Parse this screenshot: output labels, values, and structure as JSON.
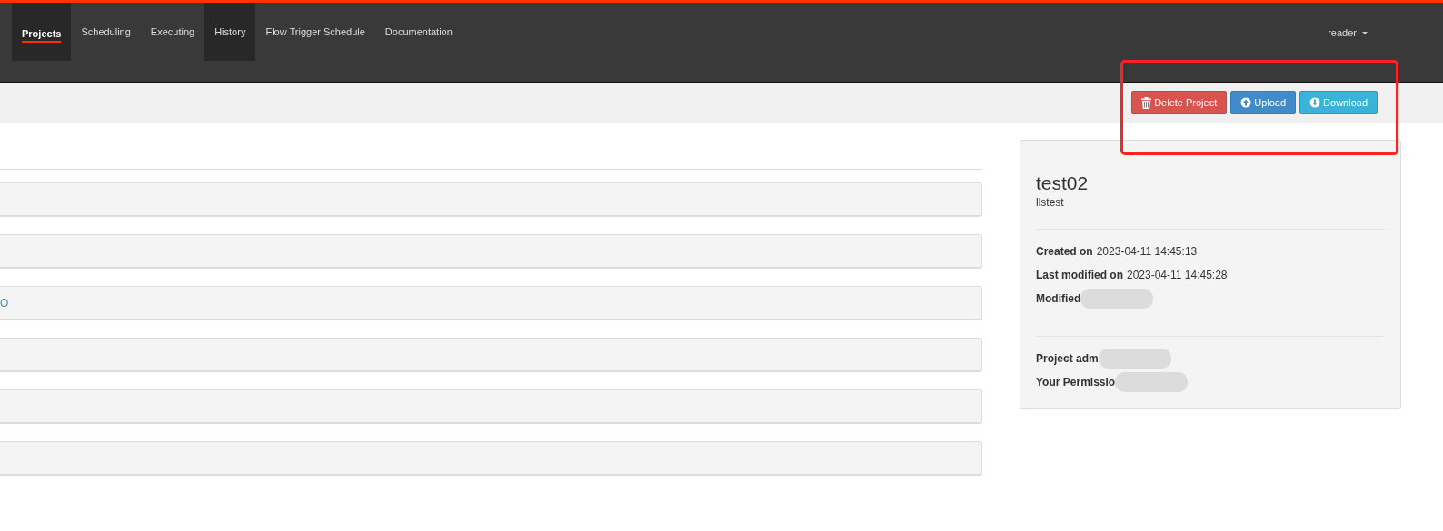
{
  "navbar": {
    "items": [
      {
        "label": "Projects",
        "selected": true,
        "highlighted": true
      },
      {
        "label": "Scheduling",
        "selected": false,
        "highlighted": false
      },
      {
        "label": "Executing",
        "selected": false,
        "highlighted": false
      },
      {
        "label": "History",
        "selected": false,
        "highlighted": true
      },
      {
        "label": "Flow Trigger Schedule",
        "selected": false,
        "highlighted": false
      },
      {
        "label": "Documentation",
        "selected": false,
        "highlighted": false
      }
    ],
    "user": "reader"
  },
  "toolbar": {
    "buttons": [
      {
        "label": "Delete Project",
        "kind": "delete"
      },
      {
        "label": "Upload",
        "kind": "upload"
      },
      {
        "label": "Download",
        "kind": "download"
      }
    ]
  },
  "flow_list": {
    "rows": [
      {},
      {},
      {
        "text": "O"
      },
      {},
      {},
      {}
    ]
  },
  "project_card": {
    "name": "test02",
    "description": "llstest",
    "details": [
      {
        "label": "Created on",
        "value": "2023-04-11 14:45:13"
      },
      {
        "label": "Last modified on",
        "value": "2023-04-11 14:45:28"
      },
      {
        "label": "Modified"
      }
    ],
    "access": [
      {
        "label": "Project adm"
      },
      {
        "label": "Your Permissio"
      }
    ]
  }
}
